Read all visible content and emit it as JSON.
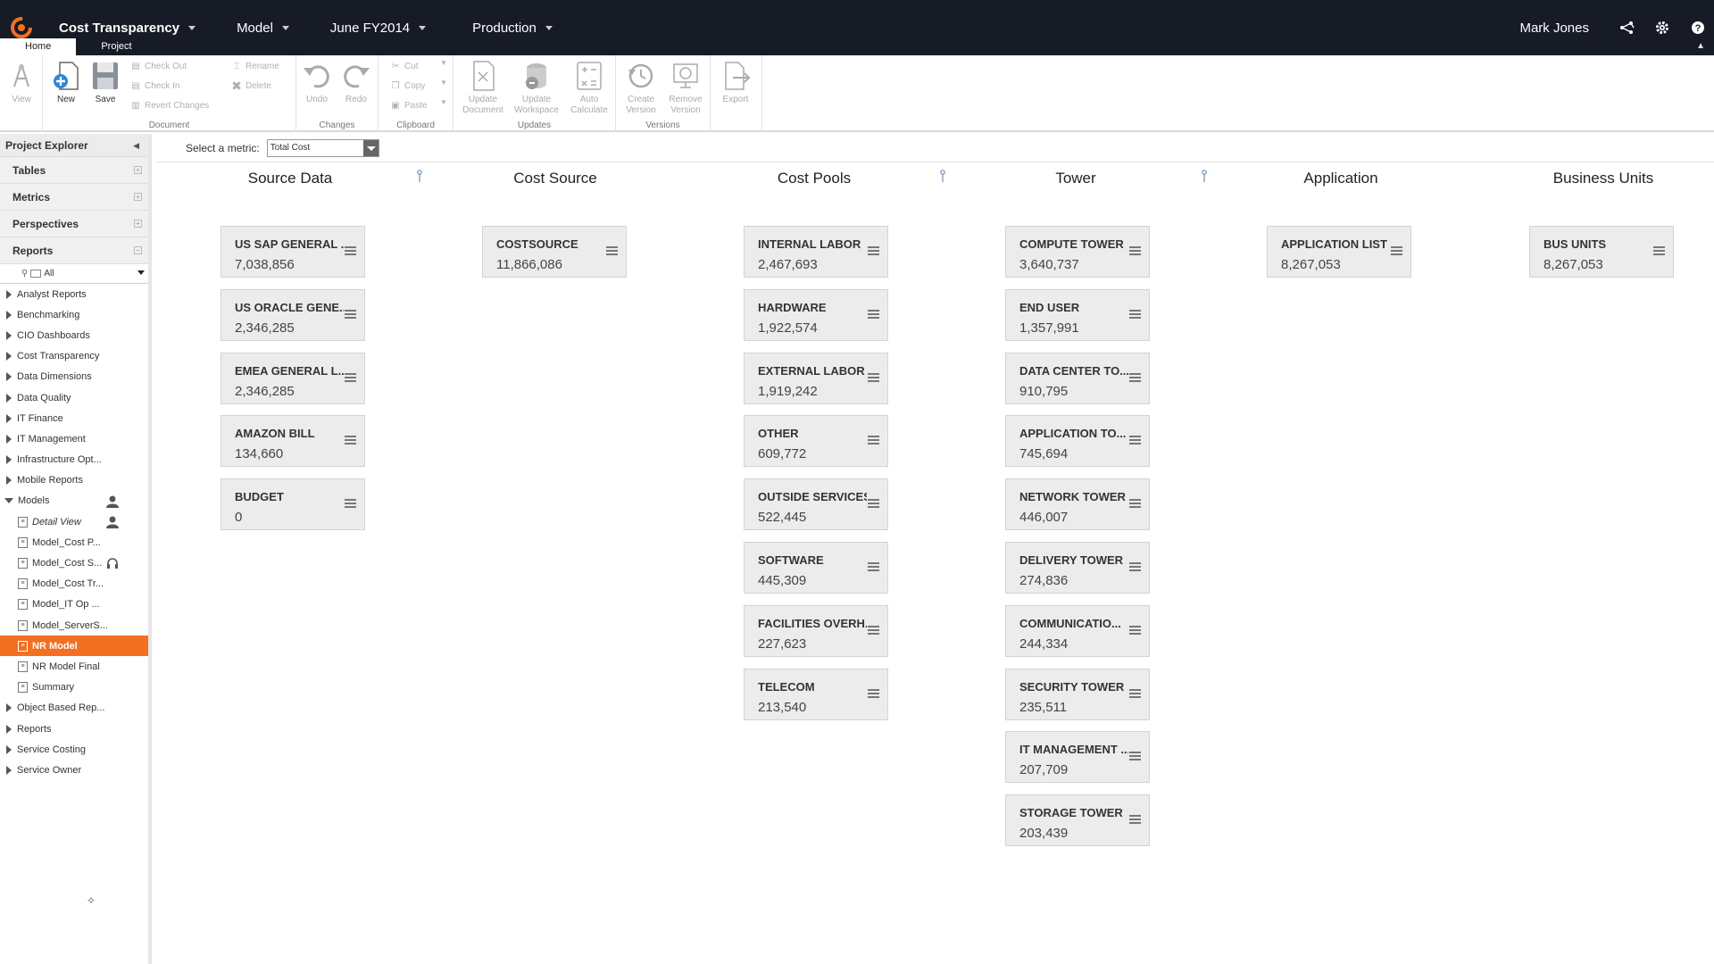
{
  "topbar": {
    "app_title": "Cost Transparency",
    "model_label": "Model",
    "period_label": "June FY2014",
    "env_label": "Production",
    "user_name": "Mark Jones"
  },
  "ribbon_tabs": [
    "Home",
    "Project"
  ],
  "ribbon": {
    "view": "View",
    "new": "New",
    "save": "Save",
    "check_out": "Check Out",
    "check_in": "Check In",
    "revert": "Revert Changes",
    "rename": "Rename",
    "delete": "Delete",
    "document_group": "Document",
    "undo": "Undo",
    "redo": "Redo",
    "changes_group": "Changes",
    "cut": "Cut",
    "copy": "Copy",
    "paste": "Paste",
    "clipboard_group": "Clipboard",
    "update_document_1": "Update",
    "update_document_2": "Document",
    "update_workspace_1": "Update",
    "update_workspace_2": "Workspace",
    "auto_calc_1": "Auto",
    "auto_calc_2": "Calculate",
    "updates_group": "Updates",
    "create_version_1": "Create",
    "create_version_2": "Version",
    "remove_version_1": "Remove",
    "remove_version_2": "Version",
    "export": "Export",
    "versions_group": "Versions"
  },
  "sidebar": {
    "title": "Project Explorer",
    "sections": [
      "Tables",
      "Metrics",
      "Perspectives",
      "Reports"
    ],
    "filter_value": "All",
    "tree": [
      {
        "label": "Analyst Reports",
        "type": "folder"
      },
      {
        "label": "Benchmarking",
        "type": "folder"
      },
      {
        "label": "CIO Dashboards",
        "type": "folder"
      },
      {
        "label": "Cost Transparency",
        "type": "folder"
      },
      {
        "label": "Data Dimensions",
        "type": "folder"
      },
      {
        "label": "Data Quality",
        "type": "folder"
      },
      {
        "label": "IT Finance",
        "type": "folder"
      },
      {
        "label": "IT Management",
        "type": "folder"
      },
      {
        "label": "Infrastructure Opt...",
        "type": "folder"
      },
      {
        "label": "Mobile Reports",
        "type": "folder"
      },
      {
        "label": "Models",
        "type": "open"
      },
      {
        "label": "Detail View",
        "type": "child"
      },
      {
        "label": "Model_Cost P...",
        "type": "child"
      },
      {
        "label": "Model_Cost S...",
        "type": "child"
      },
      {
        "label": "Model_Cost Tr...",
        "type": "child"
      },
      {
        "label": "Model_IT Op ...",
        "type": "child"
      },
      {
        "label": "Model_ServerS...",
        "type": "child"
      },
      {
        "label": "NR Model",
        "type": "child"
      },
      {
        "label": "NR Model Final",
        "type": "child"
      },
      {
        "label": "Summary",
        "type": "child"
      },
      {
        "label": "Object Based Rep...",
        "type": "folder"
      },
      {
        "label": "Reports",
        "type": "folder"
      },
      {
        "label": "Service Costing",
        "type": "folder"
      },
      {
        "label": "Service Owner",
        "type": "folder"
      }
    ]
  },
  "metric": {
    "label": "Select a metric:",
    "value": "Total Cost"
  },
  "columns": [
    {
      "title": "Source Data",
      "cards": [
        {
          "name": "US SAP GENERAL ...",
          "value": "7,038,856"
        },
        {
          "name": "US ORACLE GENE...",
          "value": "2,346,285"
        },
        {
          "name": "EMEA GENERAL L...",
          "value": "2,346,285"
        },
        {
          "name": "AMAZON BILL",
          "value": "134,660"
        },
        {
          "name": "BUDGET",
          "value": "0"
        }
      ]
    },
    {
      "title": "Cost Source",
      "cards": [
        {
          "name": "COSTSOURCE",
          "value": "11,866,086"
        }
      ]
    },
    {
      "title": "Cost Pools",
      "cards": [
        {
          "name": "INTERNAL LABOR",
          "value": "2,467,693"
        },
        {
          "name": "HARDWARE",
          "value": "1,922,574"
        },
        {
          "name": "EXTERNAL LABOR",
          "value": "1,919,242"
        },
        {
          "name": "OTHER",
          "value": "609,772"
        },
        {
          "name": "OUTSIDE SERVICES",
          "value": "522,445"
        },
        {
          "name": "SOFTWARE",
          "value": "445,309"
        },
        {
          "name": "FACILITIES OVERH...",
          "value": "227,623"
        },
        {
          "name": "TELECOM",
          "value": "213,540"
        }
      ]
    },
    {
      "title": "Tower",
      "cards": [
        {
          "name": "COMPUTE TOWER",
          "value": "3,640,737"
        },
        {
          "name": "END USER",
          "value": "1,357,991"
        },
        {
          "name": "DATA CENTER TO...",
          "value": "910,795"
        },
        {
          "name": "APPLICATION TO...",
          "value": "745,694"
        },
        {
          "name": "NETWORK TOWER",
          "value": "446,007"
        },
        {
          "name": "DELIVERY TOWER",
          "value": "274,836"
        },
        {
          "name": "COMMUNICATIO...",
          "value": "244,334"
        },
        {
          "name": "SECURITY TOWER",
          "value": "235,511"
        },
        {
          "name": "IT MANAGEMENT ...",
          "value": "207,709"
        },
        {
          "name": "STORAGE TOWER",
          "value": "203,439"
        }
      ]
    },
    {
      "title": "Application",
      "cards": [
        {
          "name": "APPLICATION LIST",
          "value": "8,267,053"
        }
      ]
    },
    {
      "title": "Business Units",
      "cards": [
        {
          "name": "BUS UNITS",
          "value": "8,267,053"
        }
      ]
    }
  ],
  "colors": {
    "topbar": "#161b26",
    "accent": "#f36f21",
    "card_bg": "#ececec"
  }
}
